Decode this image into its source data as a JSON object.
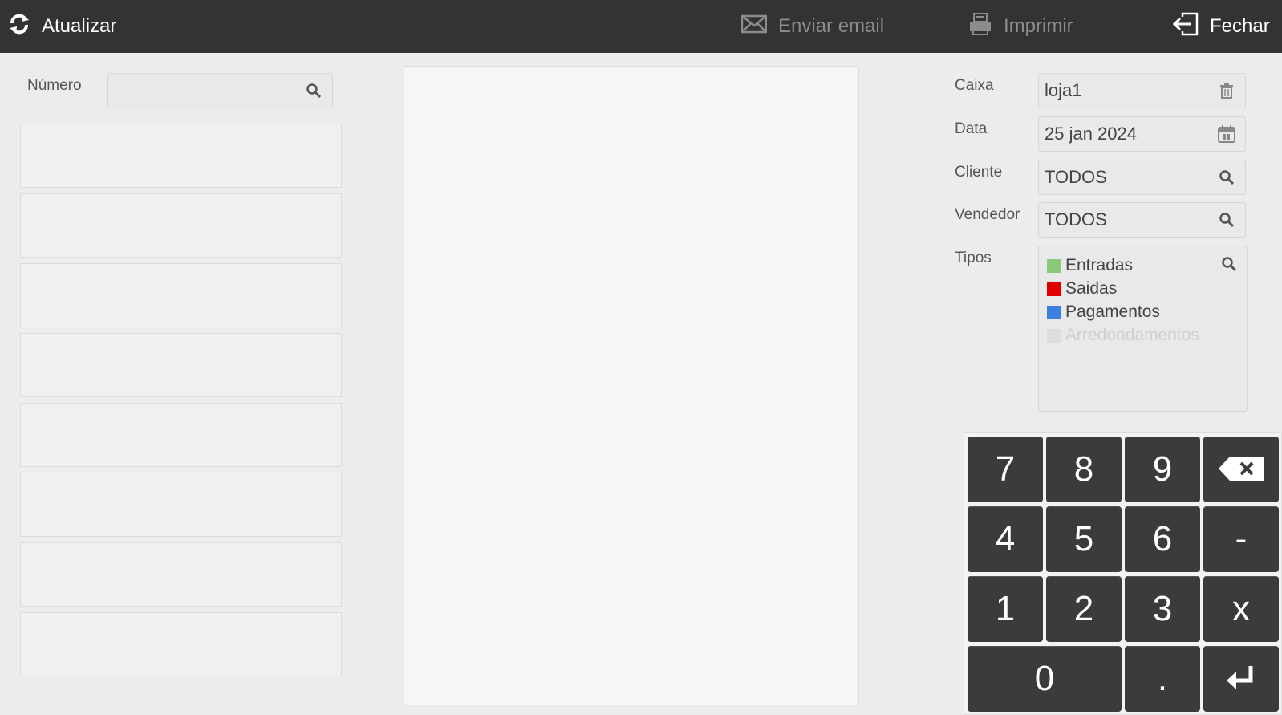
{
  "toolbar": {
    "refresh_label": "Atualizar",
    "email_label": "Enviar email",
    "print_label": "Imprimir",
    "close_label": "Fechar"
  },
  "search": {
    "numero_label": "Número",
    "numero_value": ""
  },
  "filters": {
    "caixa_label": "Caixa",
    "caixa_value": "loja1",
    "data_label": "Data",
    "data_value": "25 jan 2024",
    "cliente_label": "Cliente",
    "cliente_value": "TODOS",
    "vendedor_label": "Vendedor",
    "vendedor_value": "TODOS",
    "tipos_label": "Tipos",
    "tipos": [
      {
        "label": "Entradas",
        "color": "#8cc87a",
        "enabled": true
      },
      {
        "label": "Saidas",
        "color": "#e00000",
        "enabled": true
      },
      {
        "label": "Pagamentos",
        "color": "#3b7fe0",
        "enabled": true
      },
      {
        "label": "Arredondamentos",
        "color": "#dedede",
        "enabled": false
      }
    ]
  },
  "keypad": {
    "keys": [
      "7",
      "8",
      "9",
      "4",
      "5",
      "6",
      "-",
      "1",
      "2",
      "3",
      "x",
      "0",
      "."
    ]
  },
  "colors": {
    "topbar": "#333333",
    "key": "#3b3b3b",
    "background": "#ececec"
  }
}
